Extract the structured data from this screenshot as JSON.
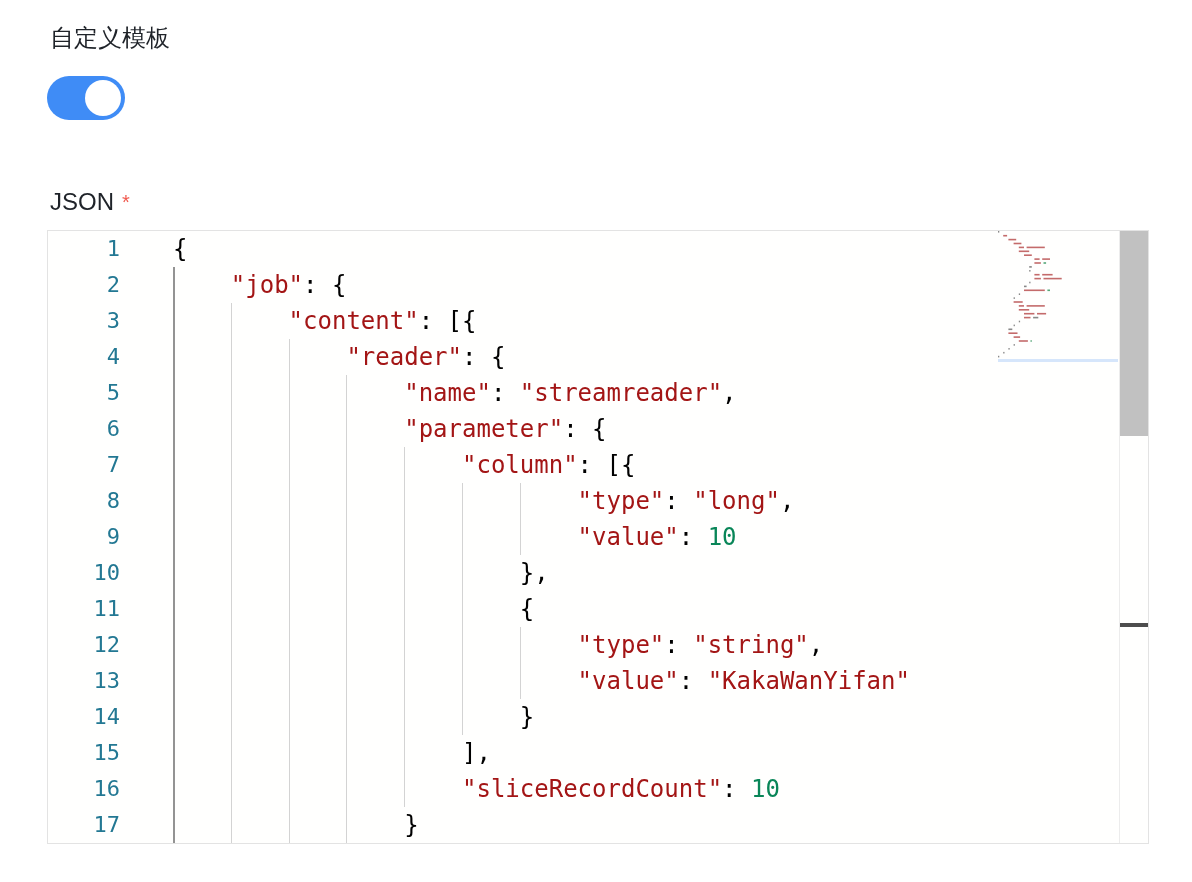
{
  "template_toggle": {
    "label": "自定义模板",
    "on": true
  },
  "json_field": {
    "label": "JSON",
    "required_mark": "*",
    "lines": [
      {
        "number": "1",
        "tokens": [
          {
            "kind": "punct",
            "text": "{"
          }
        ],
        "children": [
          {
            "number": "2",
            "tokens": [
              {
                "kind": "key",
                "text": "\"job\""
              },
              {
                "kind": "punct",
                "text": ": {"
              }
            ],
            "children": [
              {
                "number": "3",
                "tokens": [
                  {
                    "kind": "key",
                    "text": "\"content\""
                  },
                  {
                    "kind": "punct",
                    "text": ": [{"
                  }
                ],
                "children": [
                  {
                    "number": "4",
                    "tokens": [
                      {
                        "kind": "key",
                        "text": "\"reader\""
                      },
                      {
                        "kind": "punct",
                        "text": ": {"
                      }
                    ],
                    "children": [
                      {
                        "number": "5",
                        "tokens": [
                          {
                            "kind": "key",
                            "text": "\"name\""
                          },
                          {
                            "kind": "punct",
                            "text": ": "
                          },
                          {
                            "kind": "string",
                            "text": "\"streamreader\""
                          },
                          {
                            "kind": "punct",
                            "text": ","
                          }
                        ]
                      },
                      {
                        "number": "6",
                        "tokens": [
                          {
                            "kind": "key",
                            "text": "\"parameter\""
                          },
                          {
                            "kind": "punct",
                            "text": ": {"
                          }
                        ],
                        "children": [
                          {
                            "number": "7",
                            "tokens": [
                              {
                                "kind": "key",
                                "text": "\"column\""
                              },
                              {
                                "kind": "punct",
                                "text": ": [{"
                              }
                            ],
                            "children": [
                              {
                                "children": [
                                  {
                                    "number": "8",
                                    "tokens": [
                                      {
                                        "kind": "key",
                                        "text": "\"type\""
                                      },
                                      {
                                        "kind": "punct",
                                        "text": ": "
                                      },
                                      {
                                        "kind": "string",
                                        "text": "\"long\""
                                      },
                                      {
                                        "kind": "punct",
                                        "text": ","
                                      }
                                    ]
                                  },
                                  {
                                    "number": "9",
                                    "tokens": [
                                      {
                                        "kind": "key",
                                        "text": "\"value\""
                                      },
                                      {
                                        "kind": "punct",
                                        "text": ": "
                                      },
                                      {
                                        "kind": "number",
                                        "text": "10"
                                      }
                                    ]
                                  }
                                ]
                              },
                              {
                                "number": "10",
                                "tokens": [
                                  {
                                    "kind": "punct",
                                    "text": "},"
                                  }
                                ]
                              },
                              {
                                "number": "11",
                                "tokens": [
                                  {
                                    "kind": "punct",
                                    "text": "{"
                                  }
                                ],
                                "children": [
                                  {
                                    "number": "12",
                                    "tokens": [
                                      {
                                        "kind": "key",
                                        "text": "\"type\""
                                      },
                                      {
                                        "kind": "punct",
                                        "text": ": "
                                      },
                                      {
                                        "kind": "string",
                                        "text": "\"string\""
                                      },
                                      {
                                        "kind": "punct",
                                        "text": ","
                                      }
                                    ]
                                  },
                                  {
                                    "number": "13",
                                    "tokens": [
                                      {
                                        "kind": "key",
                                        "text": "\"value\""
                                      },
                                      {
                                        "kind": "punct",
                                        "text": ": "
                                      },
                                      {
                                        "kind": "string",
                                        "text": "\"KakaWanYifan\""
                                      }
                                    ]
                                  }
                                ]
                              },
                              {
                                "number": "14",
                                "tokens": [
                                  {
                                    "kind": "punct",
                                    "text": "}"
                                  }
                                ]
                              }
                            ]
                          },
                          {
                            "number": "15",
                            "tokens": [
                              {
                                "kind": "punct",
                                "text": "],"
                              }
                            ]
                          },
                          {
                            "number": "16",
                            "tokens": [
                              {
                                "kind": "key",
                                "text": "\"sliceRecordCount\""
                              },
                              {
                                "kind": "punct",
                                "text": ": "
                              },
                              {
                                "kind": "number",
                                "text": "10"
                              }
                            ]
                          }
                        ]
                      },
                      {
                        "number": "17",
                        "tokens": [
                          {
                            "kind": "punct",
                            "text": "}"
                          }
                        ]
                      }
                    ]
                  }
                ]
              }
            ]
          }
        ]
      }
    ]
  }
}
